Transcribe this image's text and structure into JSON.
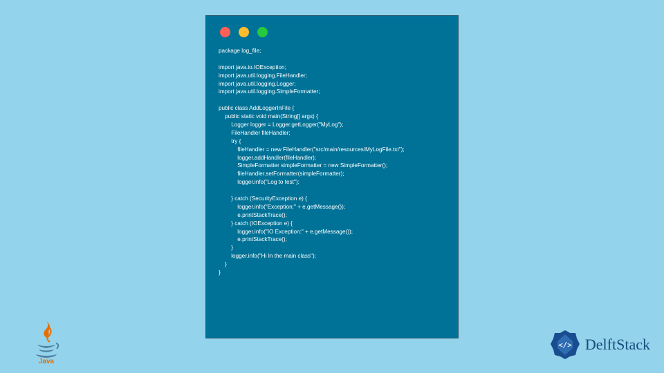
{
  "code": {
    "line1": "package log_file;",
    "line2": "",
    "line3": "import java.io.IOException;",
    "line4": "import java.util.logging.FileHandler;",
    "line5": "import java.util.logging.Logger;",
    "line6": "import java.util.logging.SimpleFormatter;",
    "line7": "",
    "line8": "public class AddLoggerInFile {",
    "line9": "    public static void main(String[] args) {",
    "line10": "        Logger logger = Logger.getLogger(\"MyLog\");",
    "line11": "        FileHandler fileHandler;",
    "line12": "        try {",
    "line13": "            fileHandler = new FileHandler(\"src/main/resources/MyLogFile.txt\");",
    "line14": "            logger.addHandler(fileHandler);",
    "line15": "            SimpleFormatter simpleFormatter = new SimpleFormatter();",
    "line16": "            fileHandler.setFormatter(simpleFormatter);",
    "line17": "            logger.info(\"Log to test\");",
    "line18": "",
    "line19": "        } catch (SecurityException e) {",
    "line20": "            logger.info(\"Exception:\" + e.getMessage());",
    "line21": "            e.printStackTrace();",
    "line22": "        } catch (IOException e) {",
    "line23": "            logger.info(\"IO Exception:\" + e.getMessage());",
    "line24": "            e.printStackTrace();",
    "line25": "        }",
    "line26": "        logger.info(\"Hi In the main class\");",
    "line27": "    }",
    "line28": "}"
  },
  "brand": {
    "delft": "DelftStack",
    "java": "Java"
  }
}
